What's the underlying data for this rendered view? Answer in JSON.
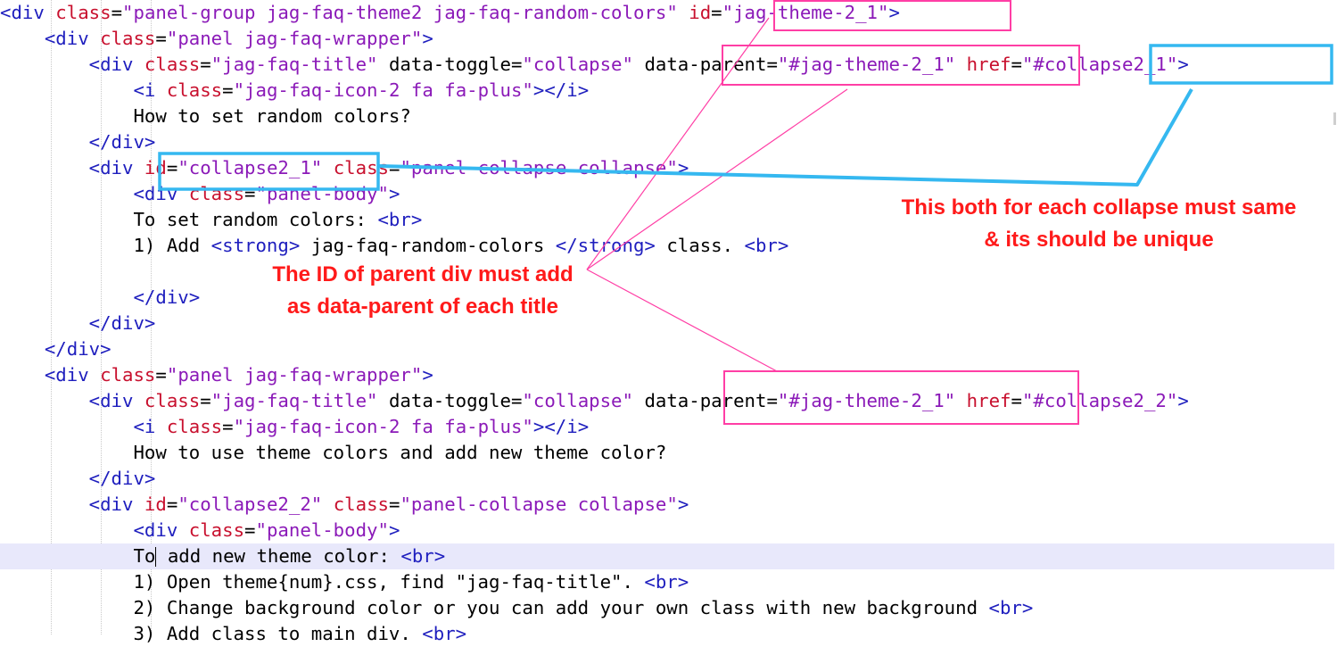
{
  "code_lines": [
    [
      [
        "t",
        "<div "
      ],
      [
        "a",
        "class"
      ],
      [
        "p",
        "="
      ],
      [
        "v",
        "\"panel-group jag-faq-theme2 jag-faq-random-colors\""
      ],
      [
        "p",
        " "
      ],
      [
        "a",
        "id"
      ],
      [
        "p",
        "="
      ],
      [
        "v",
        "\"jag-theme-2_1\""
      ],
      [
        "t",
        ">"
      ]
    ],
    [
      [
        "p",
        "    "
      ],
      [
        "t",
        "<div "
      ],
      [
        "a",
        "class"
      ],
      [
        "p",
        "="
      ],
      [
        "v",
        "\"panel jag-faq-wrapper\""
      ],
      [
        "t",
        ">"
      ]
    ],
    [
      [
        "p",
        "        "
      ],
      [
        "t",
        "<div "
      ],
      [
        "a",
        "class"
      ],
      [
        "p",
        "="
      ],
      [
        "v",
        "\"jag-faq-title\""
      ],
      [
        "p",
        " data-toggle="
      ],
      [
        "v",
        "\"collapse\""
      ],
      [
        "p",
        " data-parent="
      ],
      [
        "v",
        "\"#jag-theme-2_1\""
      ],
      [
        "p",
        " "
      ],
      [
        "a",
        "href"
      ],
      [
        "p",
        "="
      ],
      [
        "v",
        "\"#collapse2_1\""
      ],
      [
        "t",
        ">"
      ]
    ],
    [
      [
        "p",
        "            "
      ],
      [
        "t",
        "<i "
      ],
      [
        "a",
        "class"
      ],
      [
        "p",
        "="
      ],
      [
        "v",
        "\"jag-faq-icon-2 fa fa-plus\""
      ],
      [
        "t",
        "></i>"
      ]
    ],
    [
      [
        "p",
        "            How to set random colors?"
      ]
    ],
    [
      [
        "p",
        "        "
      ],
      [
        "t",
        "</div>"
      ]
    ],
    [
      [
        "p",
        "        "
      ],
      [
        "t",
        "<div "
      ],
      [
        "a",
        "id"
      ],
      [
        "p",
        "="
      ],
      [
        "v",
        "\"collapse2_1\""
      ],
      [
        "p",
        " "
      ],
      [
        "a",
        "class"
      ],
      [
        "p",
        "="
      ],
      [
        "v",
        "\"panel-collapse collapse\""
      ],
      [
        "t",
        ">"
      ]
    ],
    [
      [
        "p",
        "            "
      ],
      [
        "t",
        "<div "
      ],
      [
        "a",
        "class"
      ],
      [
        "p",
        "="
      ],
      [
        "v",
        "\"panel-body\""
      ],
      [
        "t",
        ">"
      ]
    ],
    [
      [
        "p",
        "            To set random colors: "
      ],
      [
        "t",
        "<br>"
      ]
    ],
    [
      [
        "p",
        "            1) Add "
      ],
      [
        "t",
        "<strong>"
      ],
      [
        "p",
        " jag-faq-random-colors "
      ],
      [
        "t",
        "</strong>"
      ],
      [
        "p",
        " class. "
      ],
      [
        "t",
        "<br>"
      ]
    ],
    [
      [
        "p",
        ""
      ]
    ],
    [
      [
        "p",
        "            "
      ],
      [
        "t",
        "</div>"
      ]
    ],
    [
      [
        "p",
        "        "
      ],
      [
        "t",
        "</div>"
      ]
    ],
    [
      [
        "p",
        "    "
      ],
      [
        "t",
        "</div>"
      ]
    ],
    [
      [
        "p",
        "    "
      ],
      [
        "t",
        "<div "
      ],
      [
        "a",
        "class"
      ],
      [
        "p",
        "="
      ],
      [
        "v",
        "\"panel jag-faq-wrapper\""
      ],
      [
        "t",
        ">"
      ]
    ],
    [
      [
        "p",
        "        "
      ],
      [
        "t",
        "<div "
      ],
      [
        "a",
        "class"
      ],
      [
        "p",
        "="
      ],
      [
        "v",
        "\"jag-faq-title\""
      ],
      [
        "p",
        " data-toggle="
      ],
      [
        "v",
        "\"collapse\""
      ],
      [
        "p",
        " data-parent="
      ],
      [
        "v",
        "\"#jag-theme-2_1\""
      ],
      [
        "p",
        " "
      ],
      [
        "a",
        "href"
      ],
      [
        "p",
        "="
      ],
      [
        "v",
        "\"#collapse2_2\""
      ],
      [
        "t",
        ">"
      ]
    ],
    [
      [
        "p",
        "            "
      ],
      [
        "t",
        "<i "
      ],
      [
        "a",
        "class"
      ],
      [
        "p",
        "="
      ],
      [
        "v",
        "\"jag-faq-icon-2 fa fa-plus\""
      ],
      [
        "t",
        "></i>"
      ]
    ],
    [
      [
        "p",
        "            How to use theme colors and add new theme color?"
      ]
    ],
    [
      [
        "p",
        "        "
      ],
      [
        "t",
        "</div>"
      ]
    ],
    [
      [
        "p",
        "        "
      ],
      [
        "t",
        "<div "
      ],
      [
        "a",
        "id"
      ],
      [
        "p",
        "="
      ],
      [
        "v",
        "\"collapse2_2\""
      ],
      [
        "p",
        " "
      ],
      [
        "a",
        "class"
      ],
      [
        "p",
        "="
      ],
      [
        "v",
        "\"panel-collapse collapse\""
      ],
      [
        "t",
        ">"
      ]
    ],
    [
      [
        "p",
        "            "
      ],
      [
        "t",
        "<div "
      ],
      [
        "a",
        "class"
      ],
      [
        "p",
        "="
      ],
      [
        "v",
        "\"panel-body\""
      ],
      [
        "t",
        ">"
      ]
    ],
    [
      [
        "p",
        "            To"
      ],
      [
        "caret",
        ""
      ],
      [
        "p",
        " add new theme color: "
      ],
      [
        "t",
        "<br>"
      ]
    ],
    [
      [
        "p",
        "            1) Open theme{num}.css, find \"jag-faq-title\". "
      ],
      [
        "t",
        "<br>"
      ]
    ],
    [
      [
        "p",
        "            2) Change background color or you can add your own class with new background "
      ],
      [
        "t",
        "<br>"
      ]
    ],
    [
      [
        "p",
        "            3) Add class to main div. "
      ],
      [
        "t",
        "<br>"
      ]
    ]
  ],
  "annotations": {
    "note_unique": [
      "This both for each collapse must same",
      "& its should be unique"
    ],
    "note_parent": [
      "The ID of parent div must add",
      "as data-parent of each title"
    ]
  },
  "colors": {
    "tag": "#1e1ebe",
    "attribute": "#c8102e",
    "string": "#8b1ab8",
    "current_line": "#e8e8fb",
    "pink_annotation": "#ff3ea5",
    "blue_annotation": "#35b8f0",
    "note_text": "#ff1a1a"
  }
}
